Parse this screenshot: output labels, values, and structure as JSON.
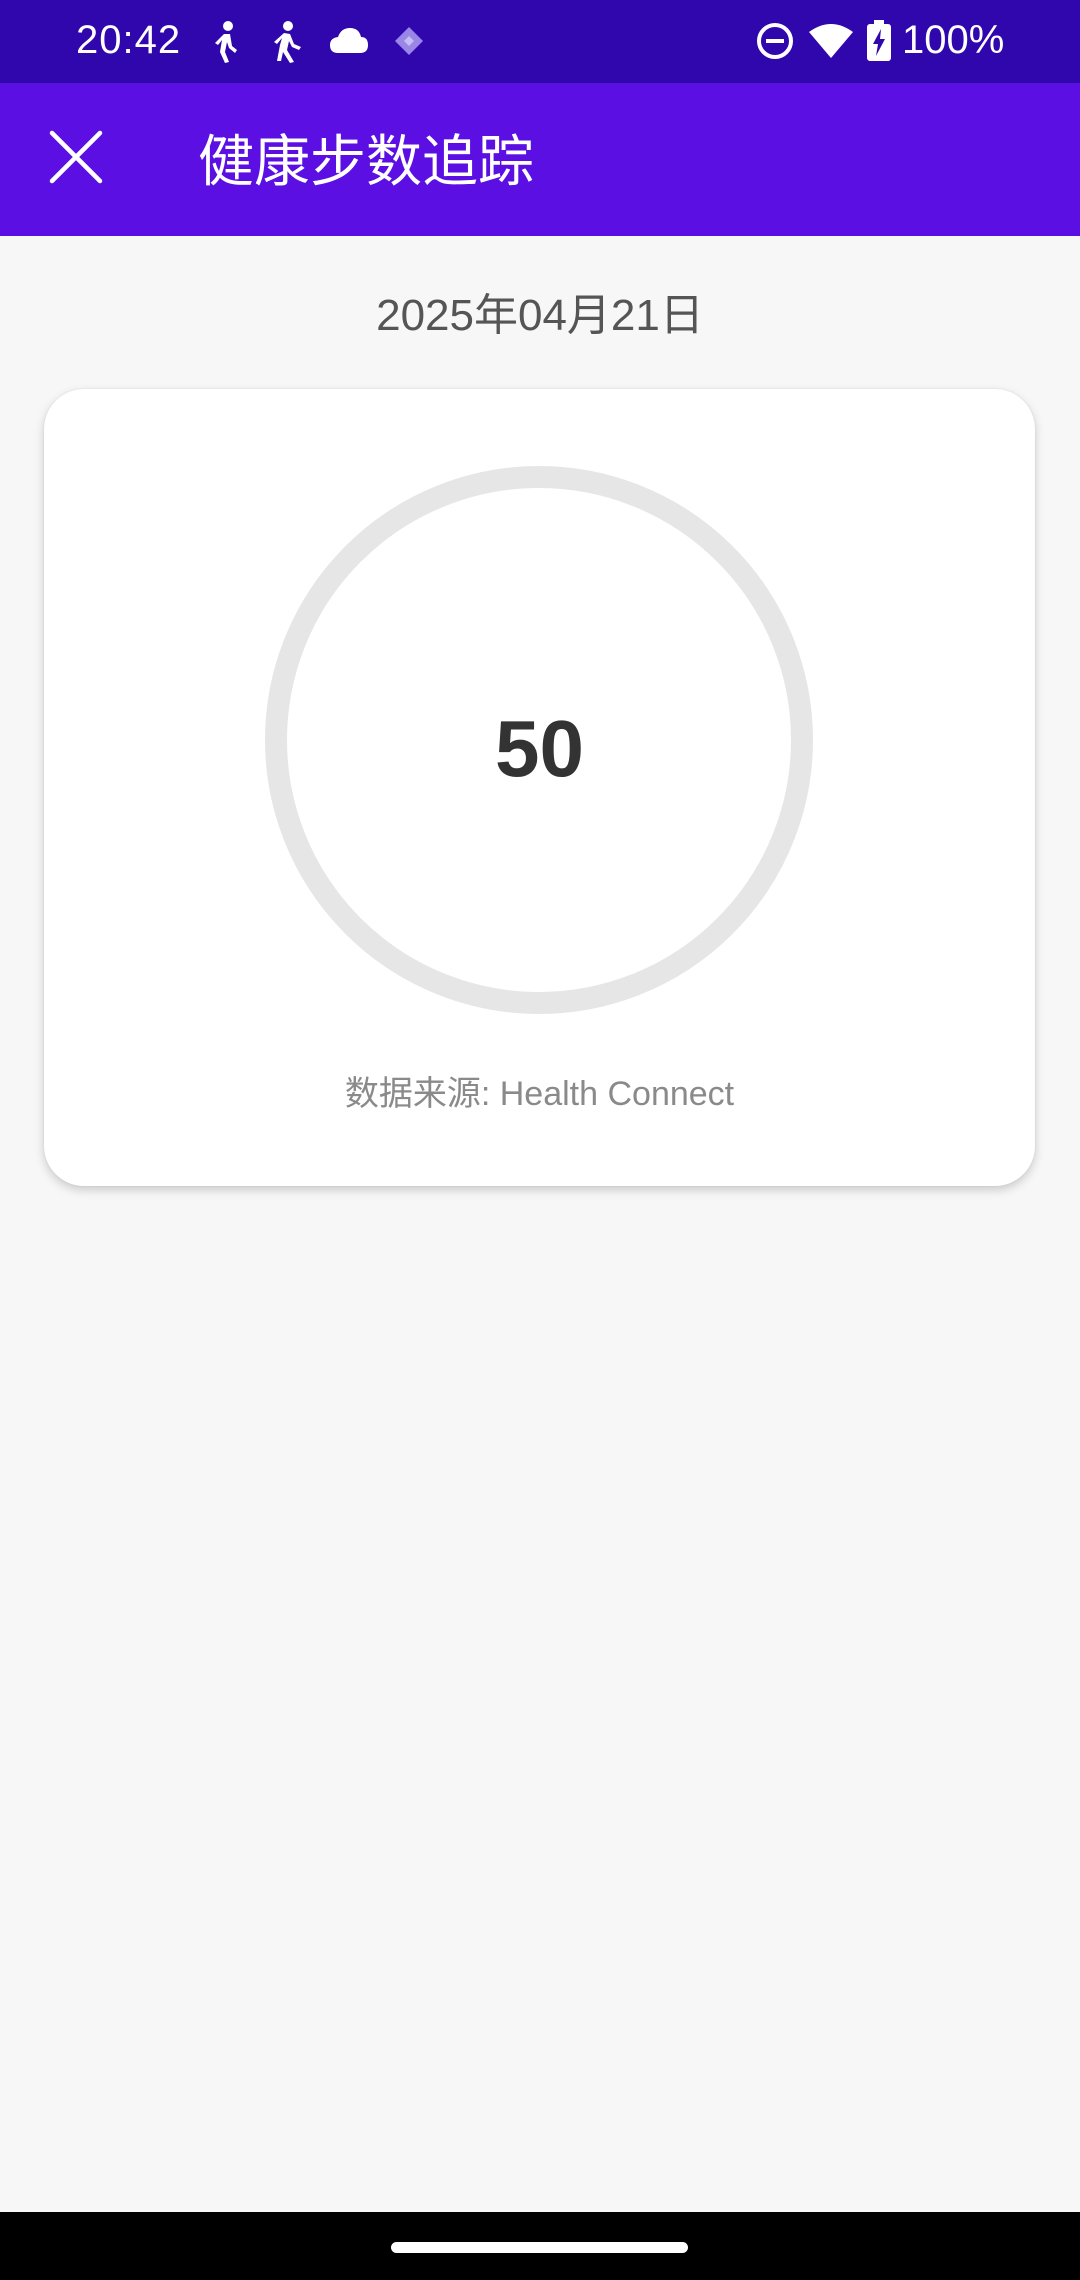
{
  "status_bar": {
    "time": "20:42",
    "battery_percent": "100%",
    "icons": [
      "walking-icon",
      "hiking-icon",
      "cloud-icon",
      "diamond-icon",
      "do-not-disturb-icon",
      "wifi-icon",
      "battery-charging-icon"
    ]
  },
  "app_bar": {
    "title": "健康步数追踪",
    "close_icon": "close-icon"
  },
  "main": {
    "date": "2025年04月21日",
    "step_card": {
      "steps": "50",
      "source": "数据来源: Health Connect"
    }
  },
  "colors": {
    "status_bar": "#3006ad",
    "app_bar": "#5b0fe3",
    "background": "#f7f7f7",
    "ring_track": "#e6e6e6",
    "step_text": "#333333"
  }
}
